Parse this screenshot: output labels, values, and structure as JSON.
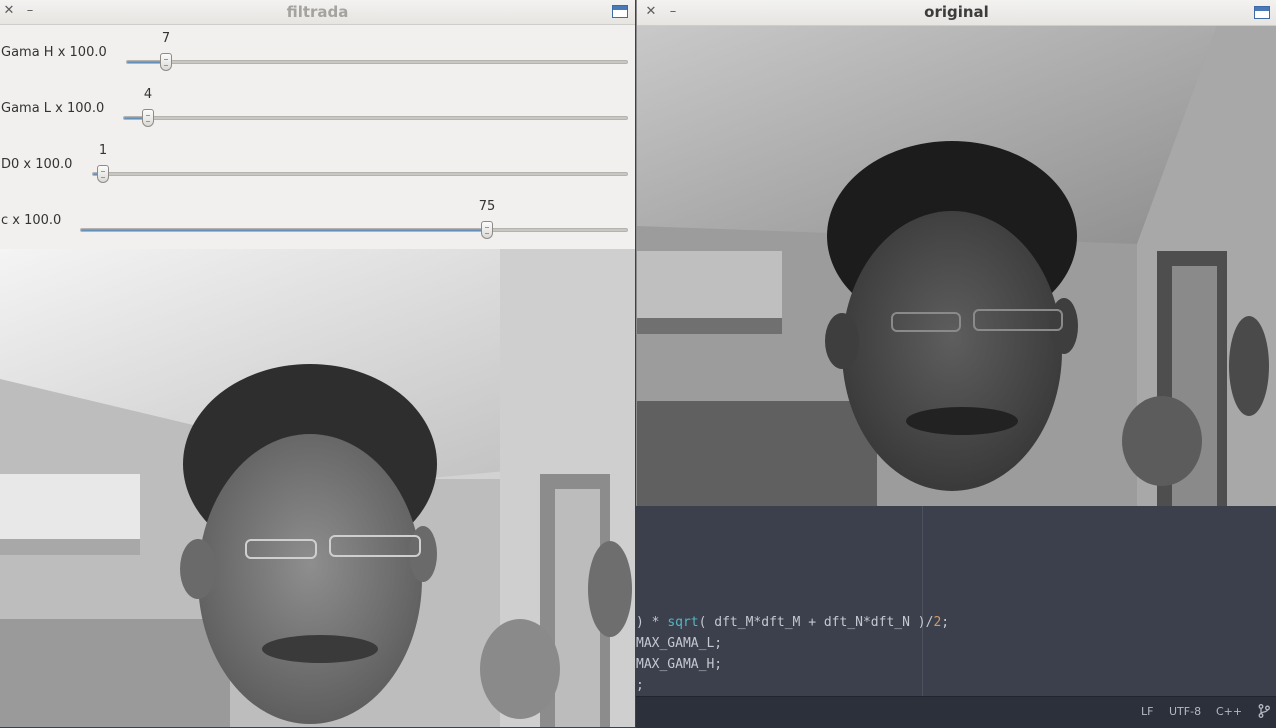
{
  "windows": {
    "filtrada": {
      "title": "filtrada",
      "close_glyph": "✕",
      "minimize_glyph": "–",
      "maximize_icon": "window-maximize-icon"
    },
    "original": {
      "title": "original",
      "close_glyph": "✕",
      "minimize_glyph": "–",
      "maximize_icon": "window-maximize-icon"
    }
  },
  "sliders": [
    {
      "label": "Gama H x 100.0",
      "value": "7",
      "max": 100
    },
    {
      "label": "Gama L x 100.0",
      "value": "4",
      "max": 100
    },
    {
      "label": "D0 x 100.0",
      "value": "1",
      "max": 100
    },
    {
      "label": "c x 100.0",
      "value": "75",
      "max": 100
    }
  ],
  "editor": {
    "lines": [
      {
        "parts": [
          [
            ") * ",
            "plain"
          ],
          [
            "sqrt",
            "fn"
          ],
          [
            "( dft_M*dft_M + dft_N*dft_N )/",
            "plain"
          ],
          [
            "2",
            "num"
          ],
          [
            ";",
            "plain"
          ]
        ]
      },
      {
        "parts": [
          [
            "MAX_GAMA_L;",
            "plain"
          ]
        ]
      },
      {
        "parts": [
          [
            "MAX_GAMA_H;",
            "plain"
          ]
        ]
      },
      {
        "parts": [
          [
            ";",
            "plain"
          ]
        ]
      }
    ]
  },
  "statusbar": {
    "line_ending": "LF",
    "encoding": "UTF-8",
    "grammar": "C++",
    "branch_icon": "git-branch-icon"
  },
  "colors": {
    "slider_fill": "#5a88b6",
    "editor_bg": "#3b404c",
    "statusbar_bg": "#2c303a"
  }
}
